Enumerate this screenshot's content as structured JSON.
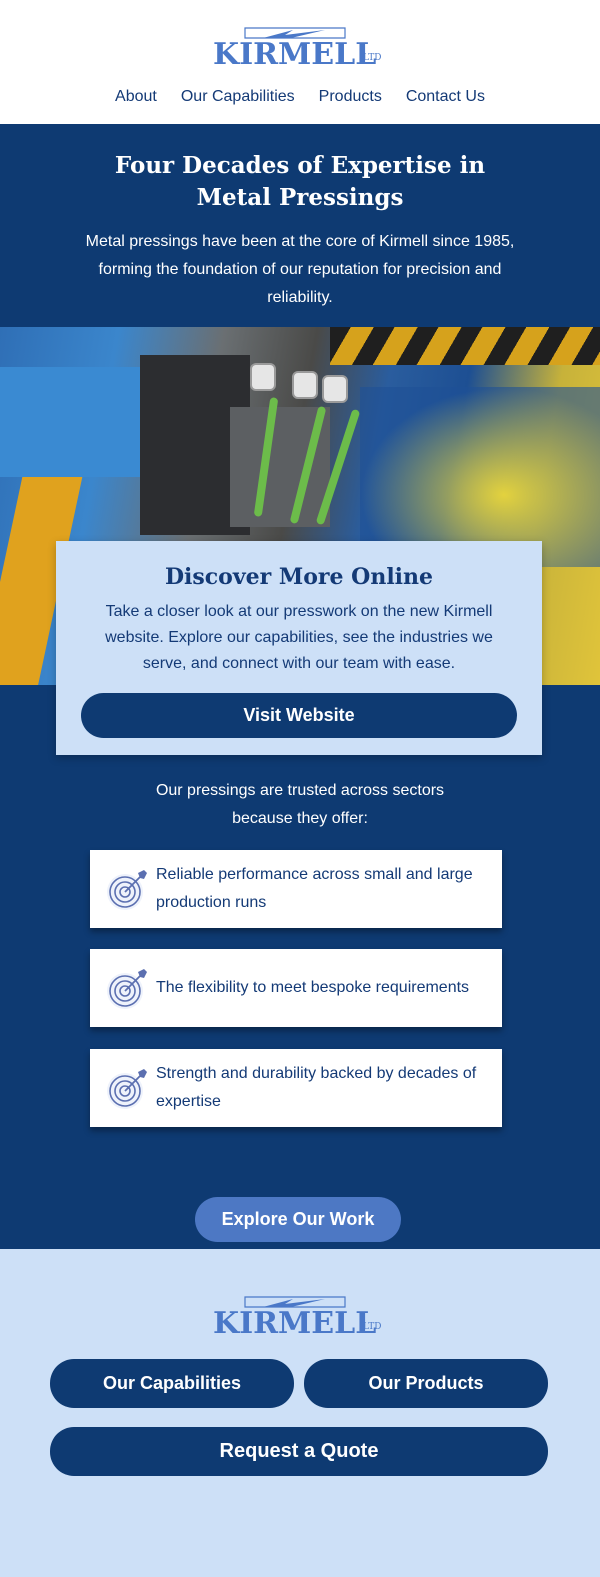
{
  "header": {
    "logo_text": "KIRMELL",
    "logo_suffix": "LTD",
    "nav": [
      "About",
      "Our Capabilities",
      "Products",
      "Contact Us"
    ]
  },
  "hero": {
    "title": "Four Decades of Expertise in Metal Pressings",
    "body": "Metal pressings have been at the core of Kirmell since 1985, forming the foundation of our reputation for precision and reliability."
  },
  "card": {
    "title": "Discover More Online",
    "body": "Take a closer look at our presswork on the new Kirmell website. Explore our capabilities, see the industries we serve, and connect with our team with ease.",
    "button": "Visit Website"
  },
  "trusted": {
    "line1": "Our pressings are trusted across sectors",
    "line2": "because they offer:"
  },
  "features": [
    {
      "icon": "target-icon",
      "text": "Reliable performance across small and large production runs"
    },
    {
      "icon": "target-icon",
      "text": "The flexibility to meet bespoke requirements"
    },
    {
      "icon": "target-icon",
      "text": "Strength and durability backed by decades of expertise"
    }
  ],
  "explore_button": "Explore Our Work",
  "footer": {
    "logo_text": "KIRMELL",
    "logo_suffix": "LTD",
    "capabilities_button": "Our Capabilities",
    "products_button": "Our Products",
    "quote_button": "Request a Quote"
  },
  "colors": {
    "navy": "#0e3a72",
    "light_blue": "#cde0f7",
    "accent_blue": "#4d78c4",
    "logo_blue": "#4a78c8"
  }
}
